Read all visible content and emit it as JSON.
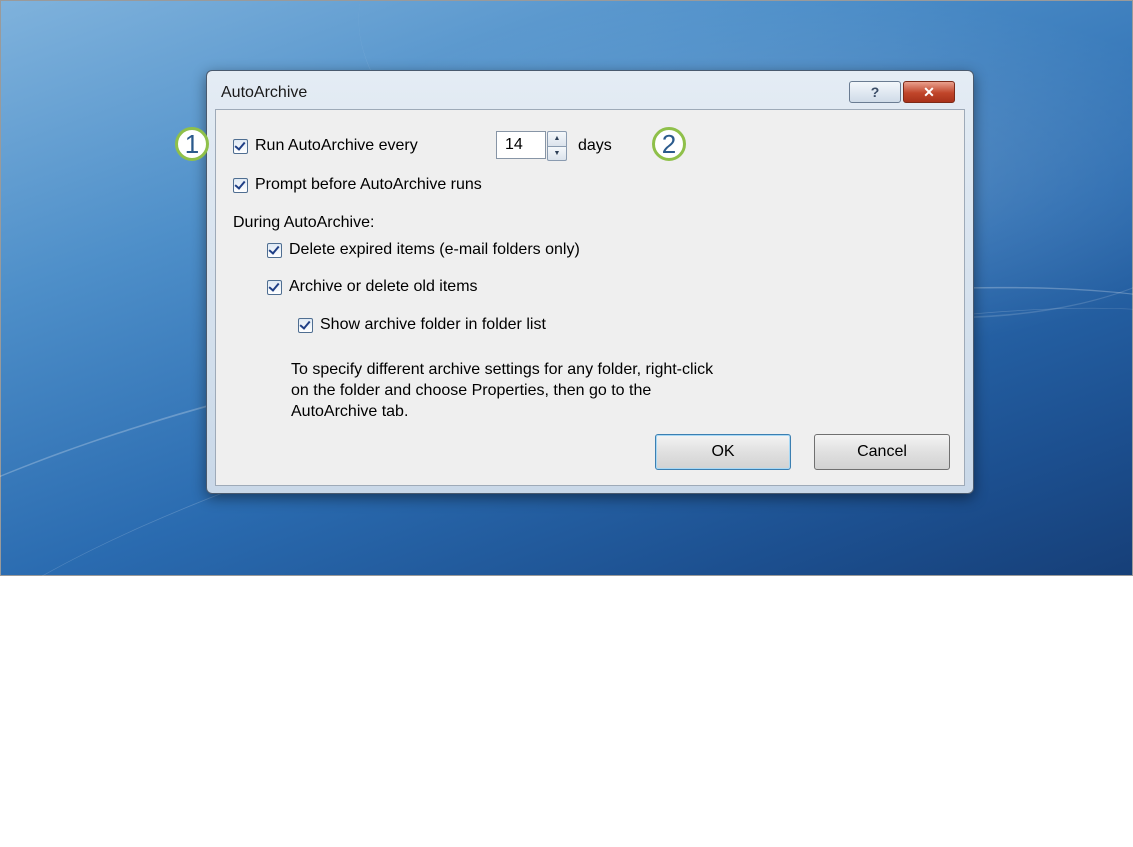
{
  "dialog": {
    "title": "AutoArchive",
    "help_glyph": "?",
    "close_glyph": "✕"
  },
  "options": {
    "run_every_label": "Run AutoArchive every",
    "run_every_value": "14",
    "days_label": "days",
    "prompt_label": "Prompt before AutoArchive runs",
    "during_label": "During AutoArchive:",
    "delete_expired_label": "Delete expired items (e-mail folders only)",
    "archive_old_label": "Archive or delete old items",
    "show_folder_label": "Show archive folder in folder list"
  },
  "note": {
    "line1": "To specify different archive settings for any folder, right-click",
    "line2": "on the folder and choose Properties, then go to the",
    "line3": "AutoArchive tab."
  },
  "buttons": {
    "ok": "OK",
    "cancel": "Cancel"
  },
  "callouts": {
    "one": "1",
    "two": "2",
    "color": "#8fc04a"
  },
  "checked": {
    "run_every": true,
    "prompt": true,
    "delete_expired": true,
    "archive_old": true,
    "show_folder": true
  }
}
